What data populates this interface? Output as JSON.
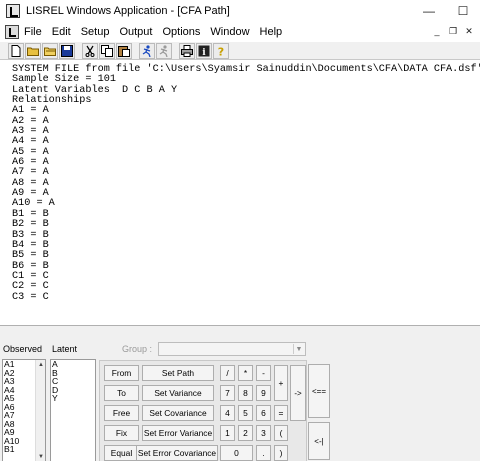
{
  "window": {
    "title": "LISREL Windows Application - [CFA Path]",
    "minimize": "—",
    "maximize": "☐"
  },
  "menu": {
    "items": [
      "File",
      "Edit",
      "Setup",
      "Output",
      "Options",
      "Window",
      "Help"
    ],
    "mdi_minimize": "_",
    "mdi_restore": "❐",
    "mdi_close": "✕"
  },
  "toolbar": {
    "icons": [
      "new-icon",
      "open-icon",
      "open-folder-icon",
      "save-icon",
      "cut-icon",
      "copy-icon",
      "paste-icon",
      "run-icon",
      "run-disabled-icon",
      "print-icon",
      "info-icon",
      "help-icon"
    ]
  },
  "editor": {
    "lines": [
      "SYSTEM FILE from file 'C:\\Users\\Syamsir Sainuddin\\Documents\\CFA\\DATA CFA.dsf'",
      "Sample Size = 101",
      "Latent Variables  D C B A Y",
      "Relationships",
      "A1 = A",
      "A2 = A",
      "A3 = A",
      "A4 = A",
      "A5 = A",
      "A6 = A",
      "A7 = A",
      "A8 = A",
      "A9 = A",
      "A10 = A",
      "B1 = B",
      "B2 = B",
      "B3 = B",
      "B4 = B",
      "B5 = B",
      "B6 = B",
      "C1 = C",
      "C2 = C",
      "C3 = C"
    ]
  },
  "panel": {
    "observed_label": "Observed",
    "latent_label": "Latent",
    "group_label": "Group :",
    "group_value": "",
    "observed": [
      "A1",
      "A2",
      "A3",
      "A4",
      "A5",
      "A6",
      "A7",
      "A8",
      "A9",
      "A10",
      "B1"
    ],
    "latent": [
      "A",
      "B",
      "C",
      "D",
      "Y"
    ],
    "buttons": {
      "from": "From",
      "to": "To",
      "free": "Free",
      "fix": "Fix",
      "equal": "Equal",
      "set_path": "Set Path",
      "set_variance": "Set Variance",
      "set_covariance": "Set Covariance",
      "set_error_variance": "Set Error Variance",
      "set_error_covariance": "Set Error Covariance",
      "k_div": "/",
      "k_mul": "*",
      "k_minus": "-",
      "k_7": "7",
      "k_8": "8",
      "k_9": "9",
      "k_4": "4",
      "k_5": "5",
      "k_6": "6",
      "k_1": "1",
      "k_2": "2",
      "k_3": "3",
      "k_0": "0",
      "k_dot": ".",
      "k_plus": "+",
      "k_eq": "=",
      "k_lparen": "(",
      "k_rparen": ")",
      "arrow_right": "->",
      "arrow_double": "<==",
      "arrow_back": "<-|"
    }
  }
}
